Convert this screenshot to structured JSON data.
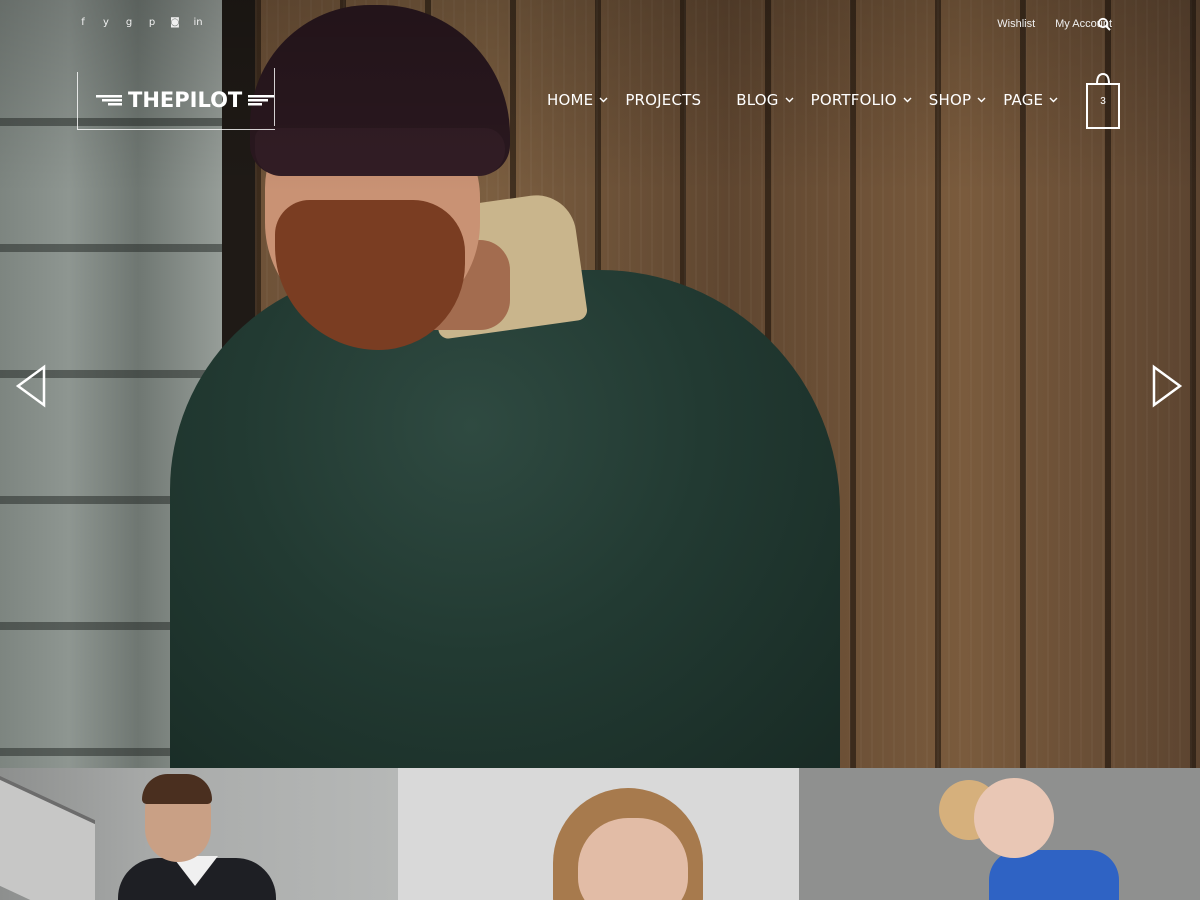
{
  "header": {
    "social_icons": [
      "facebook-icon",
      "twitter-icon",
      "google-plus-icon",
      "pinterest-icon",
      "instagram-icon",
      "linkedin-icon"
    ],
    "social_glyphs": [
      "f",
      "y",
      "g",
      "p",
      "◙",
      "in"
    ],
    "account_links": [
      "Wishlist",
      "My Account"
    ],
    "search_icon": "search-icon"
  },
  "logo": {
    "text": "THEPILOT"
  },
  "nav": {
    "items": [
      {
        "label": "HOME",
        "has_dropdown": true
      },
      {
        "label": "PROJECTS",
        "has_dropdown": false
      },
      {
        "label": "BLOG",
        "has_dropdown": true
      },
      {
        "label": "PORTFOLIO",
        "has_dropdown": true
      },
      {
        "label": "SHOP",
        "has_dropdown": true
      },
      {
        "label": "PAGE",
        "has_dropdown": true
      }
    ],
    "cart_count": "3"
  },
  "slider": {
    "prev_icon": "arrow-left-icon",
    "next_icon": "arrow-right-icon"
  },
  "colors": {
    "nav_text": "#ffffff",
    "overlay_text": "#f0f0f0"
  }
}
